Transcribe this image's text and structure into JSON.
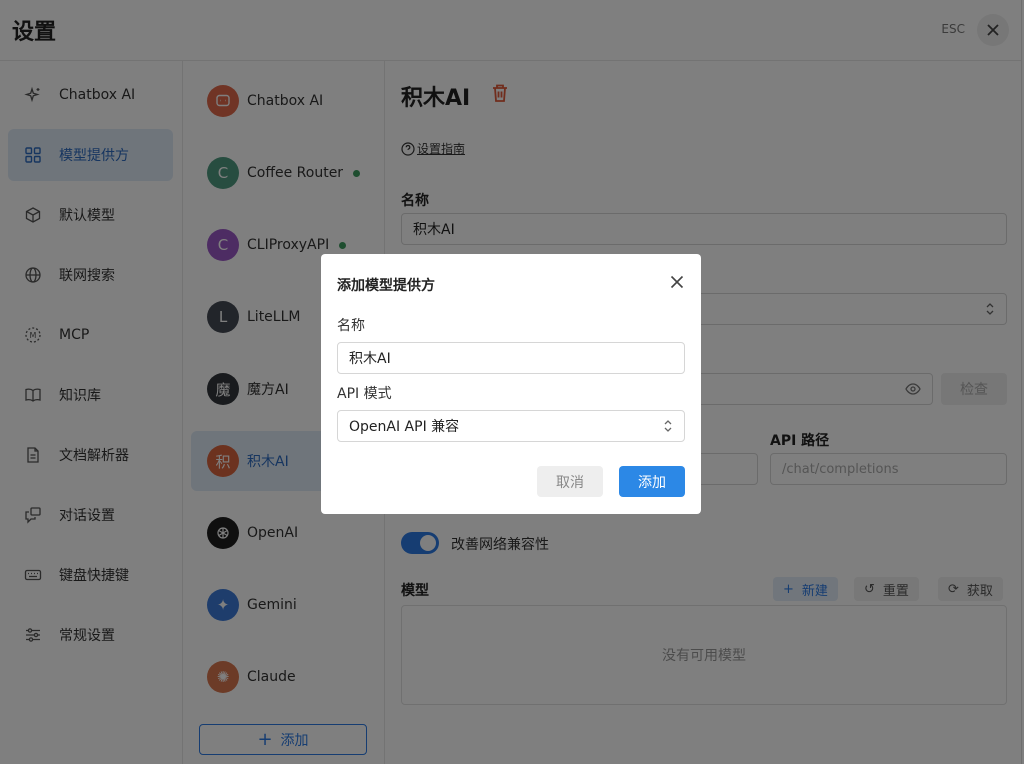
{
  "header": {
    "title": "设置",
    "esc": "ESC"
  },
  "nav": {
    "items": [
      {
        "label": "Chatbox AI",
        "icon": "sparkle-icon"
      },
      {
        "label": "模型提供方",
        "icon": "grid-icon",
        "active": true
      },
      {
        "label": "默认模型",
        "icon": "cube-icon"
      },
      {
        "label": "联网搜索",
        "icon": "globe-icon"
      },
      {
        "label": "MCP",
        "icon": "mcp-icon"
      },
      {
        "label": "知识库",
        "icon": "book-icon"
      },
      {
        "label": "文档解析器",
        "icon": "document-icon"
      },
      {
        "label": "对话设置",
        "icon": "chat-icon"
      },
      {
        "label": "键盘快捷键",
        "icon": "keyboard-icon"
      },
      {
        "label": "常规设置",
        "icon": "sliders-icon"
      }
    ]
  },
  "providers": {
    "items": [
      {
        "label": "Chatbox AI",
        "avatar": "",
        "color": "#e0694b"
      },
      {
        "label": "Coffee Router",
        "avatar": "C",
        "color": "#4f9a80",
        "dot": true
      },
      {
        "label": "CLIProxyAPI",
        "avatar": "C",
        "color": "#9b59c6",
        "dot": true
      },
      {
        "label": "LiteLLM",
        "avatar": "L",
        "color": "#454b55"
      },
      {
        "label": "魔方AI",
        "avatar": "魔",
        "color": "#33373d"
      },
      {
        "label": "积木AI",
        "avatar": "积",
        "color": "#d9643f",
        "active": true
      },
      {
        "label": "OpenAI",
        "avatar": "",
        "color": "#1f1f1f"
      },
      {
        "label": "Gemini",
        "avatar": "✦",
        "color": "#3d7ad8"
      },
      {
        "label": "Claude",
        "avatar": "✺",
        "color": "#d9764f"
      }
    ],
    "add_label": "添加"
  },
  "content": {
    "title": "积木AI",
    "guide_link": "设置指南",
    "name_label": "名称",
    "name_value": "积木AI",
    "check_button": "检查",
    "api_path_label": "API 路径",
    "api_path_placeholder": "/chat/completions",
    "compat_toggle_label": "改善网络兼容性",
    "models_label": "模型",
    "new_button": "新建",
    "reset_button": "重置",
    "fetch_button": "获取",
    "empty_models": "没有可用模型"
  },
  "modal": {
    "title": "添加模型提供方",
    "name_label": "名称",
    "name_value": "积木AI",
    "mode_label": "API 模式",
    "mode_value": "OpenAI API 兼容",
    "cancel_label": "取消",
    "add_label": "添加"
  },
  "colors": {
    "accent": "#2c88e6",
    "active_bg": "#dfeaf6",
    "delete": "#e05a3a"
  }
}
